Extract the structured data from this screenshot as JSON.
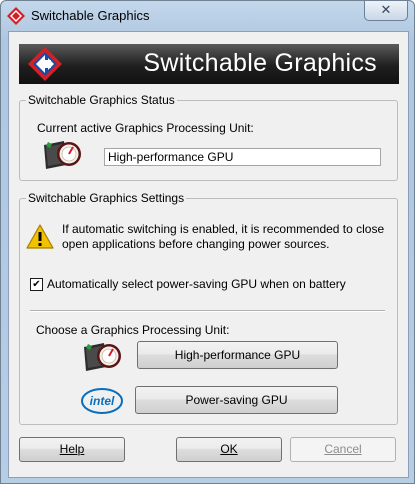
{
  "window": {
    "title": "Switchable Graphics",
    "close_symbol": "✕"
  },
  "banner": {
    "title": "Switchable Graphics",
    "logo_icon": "amd-radeon-logo-icon"
  },
  "status": {
    "group_label": "Switchable Graphics Status",
    "current_label": "Current active Graphics Processing Unit:",
    "current_value": "High-performance GPU",
    "gpu_icon": "amd-gpu-icon"
  },
  "settings": {
    "group_label": "Switchable Graphics Settings",
    "warning_icon": "warning-icon",
    "warning_text": "If automatic switching is enabled, it is recommended to close open applications before changing power sources.",
    "auto_select_checked": true,
    "auto_select_label": "Automatically select power-saving GPU when on battery",
    "choose_label": "Choose a Graphics Processing Unit:",
    "high_perf_button": "High-performance GPU",
    "power_saving_button": "Power-saving GPU",
    "intel_logo_text": "intel"
  },
  "footer": {
    "help_button": "Help",
    "ok_button": "OK",
    "cancel_button": "Cancel",
    "cancel_disabled": true
  }
}
